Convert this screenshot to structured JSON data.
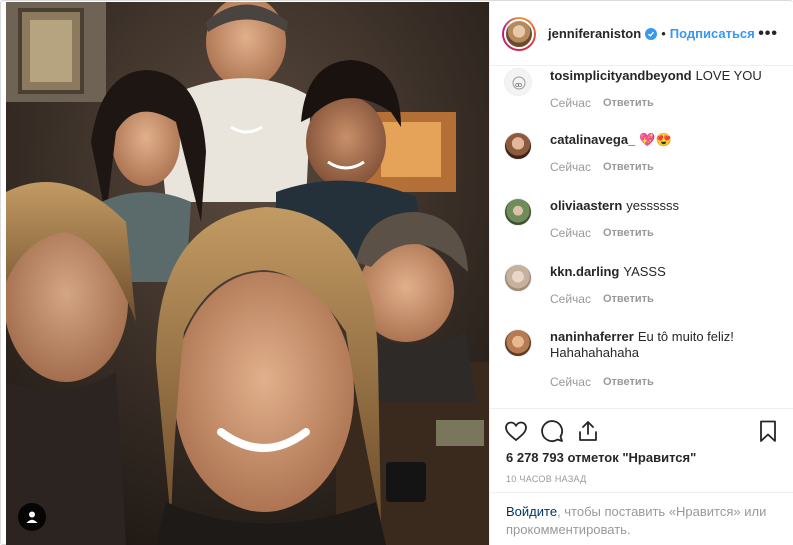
{
  "post": {
    "author": "jenniferaniston",
    "dot": "•",
    "follow_label": "Подписаться",
    "more_label": "•••",
    "likes": "6 278 793 отметок \"Нравится\"",
    "time_ago": "10 часов назад"
  },
  "comments": [
    {
      "user": "tosimplicityandbeyond",
      "text": "LOVE YOU",
      "time": "Сейчас",
      "reply": "Ответить",
      "avatar_color": "#f3f3f3"
    },
    {
      "user": "catalinavega_",
      "text": "💖😍",
      "time": "Сейчас",
      "reply": "Ответить",
      "avatar_color": "#a87a5c"
    },
    {
      "user": "oliviaastern",
      "text": "yessssss",
      "time": "Сейчас",
      "reply": "Ответить",
      "avatar_color": "#6f8c5a"
    },
    {
      "user": "kkn.darling",
      "text": "YASSS",
      "time": "Сейчас",
      "reply": "Ответить",
      "avatar_color": "#d8cfc6"
    },
    {
      "user": "naninhaferrer",
      "text": "Eu tô muito feliz! Hahahahahaha",
      "time": "Сейчас",
      "reply": "Ответить",
      "avatar_color": "#b57b52"
    }
  ],
  "login_prompt": {
    "link": "Войдите",
    "rest": ", чтобы поставить «Нравится» или прокомментировать."
  },
  "icons": [
    "user-tag-icon",
    "verified-badge-icon",
    "heart-icon",
    "comment-icon",
    "share-icon",
    "bookmark-icon"
  ],
  "colors": {
    "accent": "#3897f0",
    "muted": "#999999",
    "text": "#262626",
    "border": "#efefef"
  }
}
